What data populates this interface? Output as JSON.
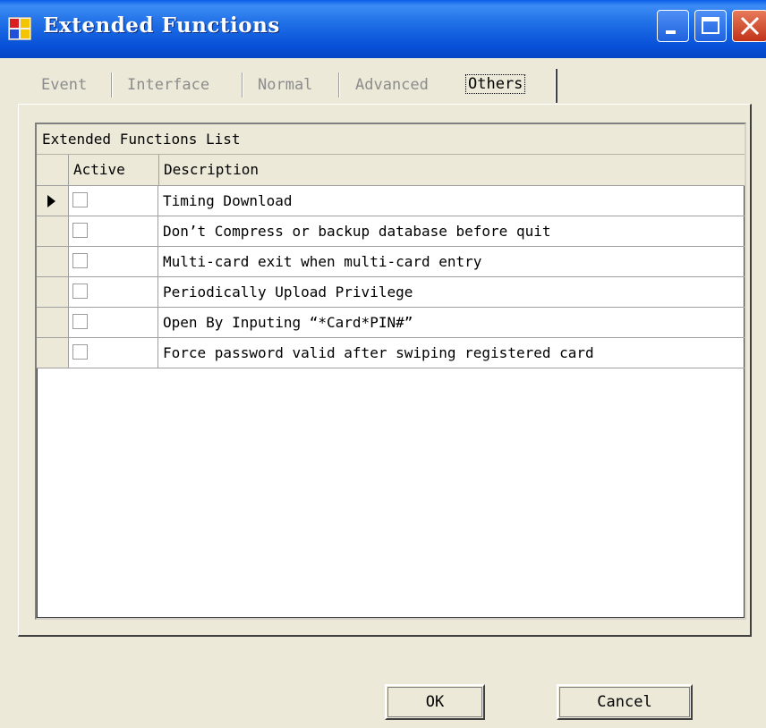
{
  "window": {
    "title": "Extended Functions"
  },
  "tabs": [
    {
      "label": "Event"
    },
    {
      "label": "Interface"
    },
    {
      "label": "Normal"
    },
    {
      "label": "Advanced"
    },
    {
      "label": "Others"
    }
  ],
  "active_tab": "Others",
  "grid": {
    "caption": "Extended Functions List",
    "columns": [
      "Active",
      "Description"
    ],
    "rows": [
      {
        "active": false,
        "description": "Timing Download"
      },
      {
        "active": false,
        "description": "Don’t Compress or backup database before quit"
      },
      {
        "active": false,
        "description": "Multi-card exit when multi-card entry"
      },
      {
        "active": false,
        "description": "Periodically Upload Privilege"
      },
      {
        "active": false,
        "description": "Open By Inputing “*Card*PIN#”"
      },
      {
        "active": false,
        "description": "Force password valid after swiping registered card"
      }
    ],
    "current_row": 1
  },
  "buttons": {
    "ok": "OK",
    "cancel": "Cancel"
  },
  "colors": {
    "titlebar": "#0a5fe8",
    "window_bg": "#ece9d8",
    "close_button": "#c1331a"
  }
}
